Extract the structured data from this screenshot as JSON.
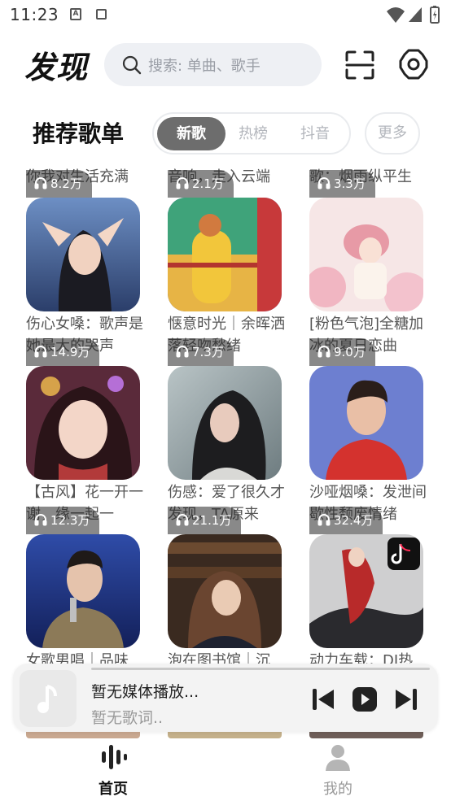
{
  "status_bar": {
    "time": "11:23"
  },
  "header": {
    "title": "发现",
    "search_placeholder": "搜索: 单曲、歌手"
  },
  "section": {
    "title": "推荐歌单",
    "tabs": [
      {
        "label": "新歌",
        "active": true
      },
      {
        "label": "热榜",
        "active": false
      },
      {
        "label": "抖音",
        "active": false
      }
    ],
    "more_label": "更多"
  },
  "peek_titles": [
    "你我对生活充满",
    "音响，走入云端",
    "歌：烟雨纵平生"
  ],
  "playlists": [
    {
      "plays": "8.2万",
      "title": "伤心女嗓：歌声是她最大的哭声"
    },
    {
      "plays": "2.1万",
      "title": "惬意时光｜余晖洒落轻吻愁绪"
    },
    {
      "plays": "3.3万",
      "title": "[粉色气泡]全糖加冰的夏日恋曲"
    },
    {
      "plays": "14.9万",
      "title": "【古风】花一开一谢，缘一起一"
    },
    {
      "plays": "7.3万",
      "title": "伤感：爱了很久才发现，TA原来"
    },
    {
      "plays": "9.0万",
      "title": "沙哑烟嗓：发泄间歇性颓废情绪"
    },
    {
      "plays": "12.3万",
      "title": "女歌男唱｜品味"
    },
    {
      "plays": "21.1万",
      "title": "泡在图书馆｜沉"
    },
    {
      "plays": "32.4万",
      "title": "动力车载：DJ热"
    }
  ],
  "player": {
    "title": "暂无媒体播放...",
    "subtitle": "暂无歌词.."
  },
  "nav": [
    {
      "label": "首页",
      "active": true,
      "icon": "waveform-icon"
    },
    {
      "label": "我的",
      "active": false,
      "icon": "user-icon"
    }
  ]
}
